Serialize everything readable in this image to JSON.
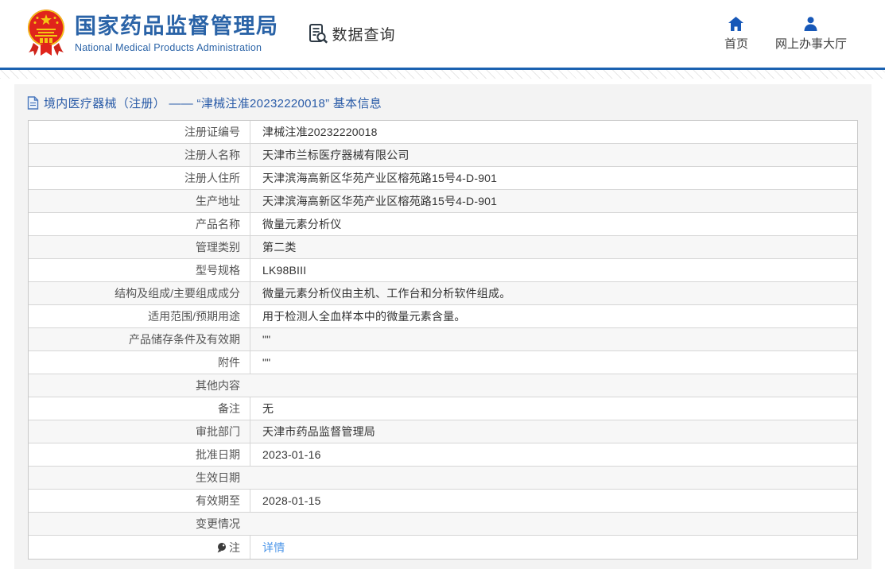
{
  "header": {
    "brand": {
      "name_cn": "国家药品监督管理局",
      "name_en": "National Medical Products Administration"
    },
    "data_query_label": "数据查询",
    "nav": [
      {
        "label": "首页",
        "icon": "home-icon"
      },
      {
        "label": "网上办事大厅",
        "icon": "person-icon"
      }
    ]
  },
  "page": {
    "title": "境内医疗器械（注册） —— “津械注准20232220018” 基本信息"
  },
  "table": {
    "rows": [
      {
        "label": "注册证编号",
        "value": "津械注准20232220018"
      },
      {
        "label": "注册人名称",
        "value": "天津市兰标医疗器械有限公司"
      },
      {
        "label": "注册人住所",
        "value": "天津滨海高新区华苑产业区榕苑路15号4-D-901"
      },
      {
        "label": "生产地址",
        "value": "天津滨海高新区华苑产业区榕苑路15号4-D-901"
      },
      {
        "label": "产品名称",
        "value": "微量元素分析仪"
      },
      {
        "label": "管理类别",
        "value": "第二类"
      },
      {
        "label": "型号规格",
        "value": "LK98BIII"
      },
      {
        "label": "结构及组成/主要组成成分",
        "value": "微量元素分析仪由主机、工作台和分析软件组成。"
      },
      {
        "label": "适用范围/预期用途",
        "value": "用于检测人全血样本中的微量元素含量。"
      },
      {
        "label": "产品储存条件及有效期",
        "value": "\"\""
      },
      {
        "label": "附件",
        "value": "\"\""
      },
      {
        "label": "其他内容",
        "value": "",
        "empty": true
      },
      {
        "label": "备注",
        "value": "无"
      },
      {
        "label": "审批部门",
        "value": "天津市药品监督管理局"
      },
      {
        "label": "批准日期",
        "value": "2023-01-16"
      },
      {
        "label": "生效日期",
        "value": "",
        "empty": true
      },
      {
        "label": "有效期至",
        "value": "2028-01-15"
      },
      {
        "label": "变更情况",
        "value": "",
        "empty": true
      },
      {
        "label": "注",
        "value": "详情",
        "link": true,
        "icon": "note-bulb-icon"
      }
    ]
  },
  "colors": {
    "brand_blue": "#2a63a7",
    "rule_blue": "#1b62b1",
    "title_blue": "#2b5ca8",
    "link_blue": "#4a94e8",
    "icon_blue": "#1758b8",
    "panel_gray": "#f3f3f3"
  }
}
